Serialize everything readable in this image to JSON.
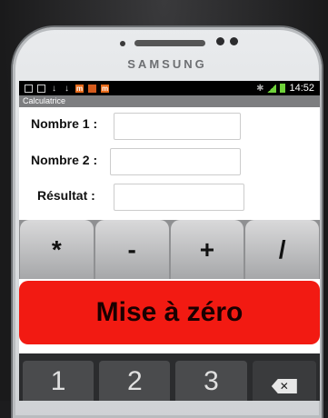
{
  "phone": {
    "brand": "SAMSUNG"
  },
  "status_bar": {
    "time": "14:52",
    "icons": [
      "note-icon",
      "download-icon",
      "download-icon",
      "m-icon",
      "picture-icon",
      "m-icon"
    ]
  },
  "app": {
    "title": "Calculatrice",
    "fields": [
      {
        "label": "Nombre 1 :",
        "value": ""
      },
      {
        "label": "Nombre 2 :",
        "value": ""
      },
      {
        "label": "Résultat :",
        "value": ""
      }
    ],
    "operators": [
      "*",
      "-",
      "+",
      "/"
    ],
    "reset_label": "Mise à zéro"
  },
  "keyboard": {
    "keys": [
      "1",
      "2",
      "3"
    ],
    "delete_icon": "backspace-icon"
  },
  "colors": {
    "reset": "#f21a12",
    "operator_bg": "#c0c1c3",
    "title_bar": "#7d7e80"
  }
}
